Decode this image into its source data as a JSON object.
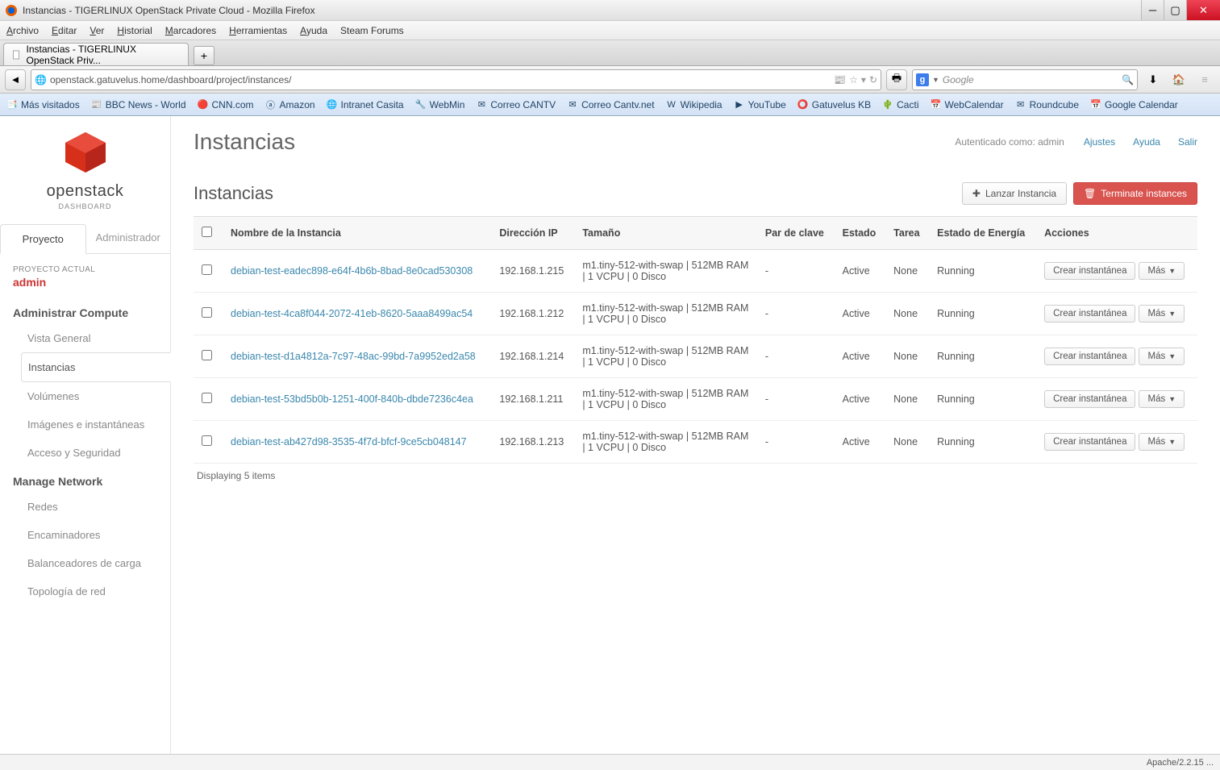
{
  "window": {
    "title": "Instancias - TIGERLINUX OpenStack Private Cloud - Mozilla Firefox"
  },
  "menus": [
    "Archivo",
    "Editar",
    "Ver",
    "Historial",
    "Marcadores",
    "Herramientas",
    "Ayuda",
    "Steam Forums"
  ],
  "tab": {
    "label": "Instancias - TIGERLINUX OpenStack Priv..."
  },
  "url": "openstack.gatuvelus.home/dashboard/project/instances/",
  "search": {
    "placeholder": "Google"
  },
  "bookmarks": [
    "Más visitados",
    "BBC News - World",
    "CNN.com",
    "Amazon",
    "Intranet Casita",
    "WebMin",
    "Correo CANTV",
    "Correo Cantv.net",
    "Wikipedia",
    "YouTube",
    "Gatuvelus KB",
    "Cacti",
    "WebCalendar",
    "Roundcube",
    "Google Calendar"
  ],
  "logo": {
    "name": "openstack",
    "sub": "DASHBOARD"
  },
  "side_tabs": {
    "proyecto": "Proyecto",
    "admin": "Administrador"
  },
  "project": {
    "label": "PROYECTO ACTUAL",
    "name": "admin"
  },
  "sections": {
    "compute": {
      "title": "Administrar Compute",
      "items": [
        "Vista General",
        "Instancias",
        "Volúmenes",
        "Imágenes e instantáneas",
        "Acceso y Seguridad"
      ],
      "active_index": 1
    },
    "network": {
      "title": "Manage Network",
      "items": [
        "Redes",
        "Encaminadores",
        "Balanceadores de carga",
        "Topología de red"
      ]
    }
  },
  "header": {
    "title": "Instancias",
    "auth": "Autenticado como: admin",
    "links": [
      "Ajustes",
      "Ayuda",
      "Salir"
    ],
    "subtitle": "Instancias",
    "launch": "Lanzar Instancia",
    "terminate": "Terminate instances"
  },
  "table": {
    "cols": [
      "",
      "Nombre de la Instancia",
      "Dirección IP",
      "Tamaño",
      "Par de clave",
      "Estado",
      "Tarea",
      "Estado de Energía",
      "Acciones"
    ],
    "snapshot_label": "Crear instantánea",
    "more_label": "Más",
    "rows": [
      {
        "name": "debian-test-eadec898-e64f-4b6b-8bad-8e0cad530308",
        "ip": "192.168.1.215",
        "size": "m1.tiny-512-with-swap | 512MB RAM | 1 VCPU | 0 Disco",
        "key": "-",
        "state": "Active",
        "task": "None",
        "power": "Running"
      },
      {
        "name": "debian-test-4ca8f044-2072-41eb-8620-5aaa8499ac54",
        "ip": "192.168.1.212",
        "size": "m1.tiny-512-with-swap | 512MB RAM | 1 VCPU | 0 Disco",
        "key": "-",
        "state": "Active",
        "task": "None",
        "power": "Running"
      },
      {
        "name": "debian-test-d1a4812a-7c97-48ac-99bd-7a9952ed2a58",
        "ip": "192.168.1.214",
        "size": "m1.tiny-512-with-swap | 512MB RAM | 1 VCPU | 0 Disco",
        "key": "-",
        "state": "Active",
        "task": "None",
        "power": "Running"
      },
      {
        "name": "debian-test-53bd5b0b-1251-400f-840b-dbde7236c4ea",
        "ip": "192.168.1.211",
        "size": "m1.tiny-512-with-swap | 512MB RAM | 1 VCPU | 0 Disco",
        "key": "-",
        "state": "Active",
        "task": "None",
        "power": "Running"
      },
      {
        "name": "debian-test-ab427d98-3535-4f7d-bfcf-9ce5cb048147",
        "ip": "192.168.1.213",
        "size": "m1.tiny-512-with-swap | 512MB RAM | 1 VCPU | 0 Disco",
        "key": "-",
        "state": "Active",
        "task": "None",
        "power": "Running"
      }
    ],
    "footer": "Displaying 5 items"
  },
  "status": {
    "right": "Apache/2.2.15 ..."
  }
}
